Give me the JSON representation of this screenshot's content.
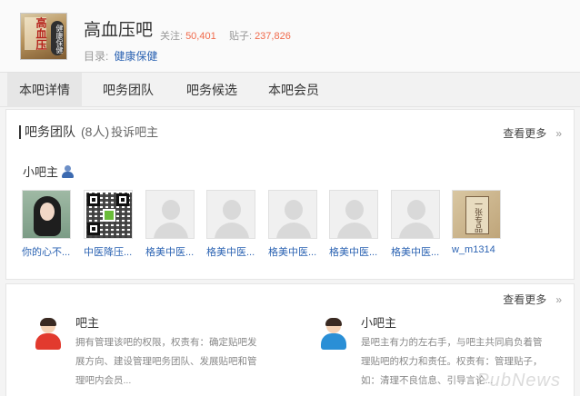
{
  "header": {
    "logo_text": "高血压",
    "logo_badge": "健康保健",
    "forum_name": "高血压吧",
    "follow_label": "关注:",
    "follow_count": "50,401",
    "posts_label": "贴子:",
    "posts_count": "237,826",
    "directory_label": "目录:",
    "directory_link": "健康保健"
  },
  "tabs": [
    {
      "label": "本吧详情",
      "active": true
    },
    {
      "label": "吧务团队",
      "active": false
    },
    {
      "label": "吧务候选",
      "active": false
    },
    {
      "label": "本吧会员",
      "active": false
    }
  ],
  "team": {
    "title": "吧务团队",
    "count": "(8人)",
    "complain_link": "投诉吧主",
    "more_label": "查看更多",
    "more_arrows": "»",
    "sub_title": "小吧主",
    "members": [
      {
        "name": "你的心不...",
        "avatar": "girl"
      },
      {
        "name": "中医降压...",
        "avatar": "qr"
      },
      {
        "name": "格美中医...",
        "avatar": "default"
      },
      {
        "name": "格美中医...",
        "avatar": "default"
      },
      {
        "name": "格美中医...",
        "avatar": "default"
      },
      {
        "name": "格美中医...",
        "avatar": "default"
      },
      {
        "name": "格美中医...",
        "avatar": "default"
      },
      {
        "name": "w_m1314",
        "avatar": "book"
      }
    ],
    "book_text": "一张专品"
  },
  "roles": {
    "more_label": "查看更多",
    "more_arrows": "»",
    "owner": {
      "title": "吧主",
      "desc": "拥有管理该吧的权限，权责有：确定贴吧发展方向、建设管理吧务团队、发展贴吧和管理吧内会员..."
    },
    "assistant": {
      "title": "小吧主",
      "desc": "是吧主有力的左右手，与吧主共同肩负着管理贴吧的权力和责任。权责有：管理贴子，如：清理不良信息、引导言论..."
    },
    "watermark": "PubNews"
  },
  "colors": {
    "accent_link": "#2d64b3",
    "stat_number": "#f06a4b",
    "owner_icon": "#e23a2e",
    "assistant_icon": "#2a8fd6"
  }
}
